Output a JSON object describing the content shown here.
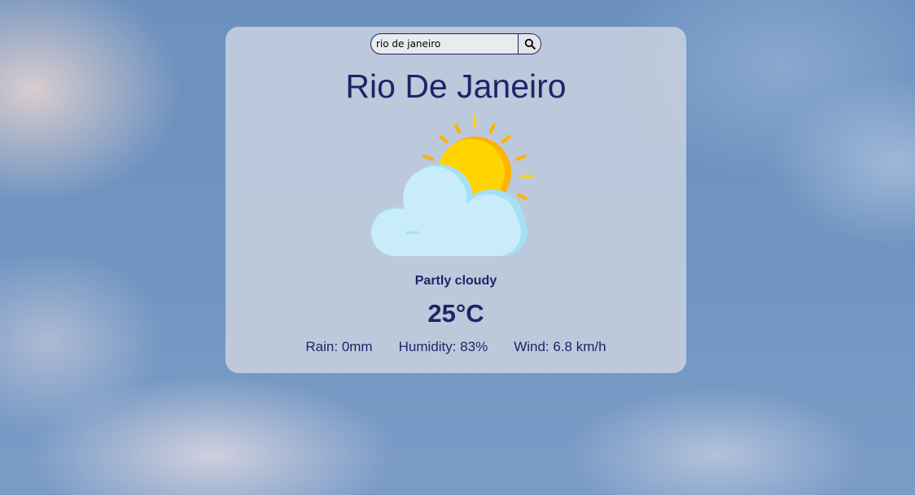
{
  "search": {
    "value": "rio de janeiro"
  },
  "city": "Rio De Janeiro",
  "condition": "Partly cloudy",
  "temperature": "25°C",
  "stats": {
    "rain": "Rain: 0mm",
    "humidity": "Humidity: 83%",
    "wind": "Wind: 6.8 km/h"
  },
  "icons": {
    "search": "search-icon",
    "weather": "partly-cloudy-icon"
  },
  "colors": {
    "text": "#1e2468",
    "card": "#cdd4e0",
    "sun": "#ffd400",
    "cloud": "#c9ecfb"
  }
}
